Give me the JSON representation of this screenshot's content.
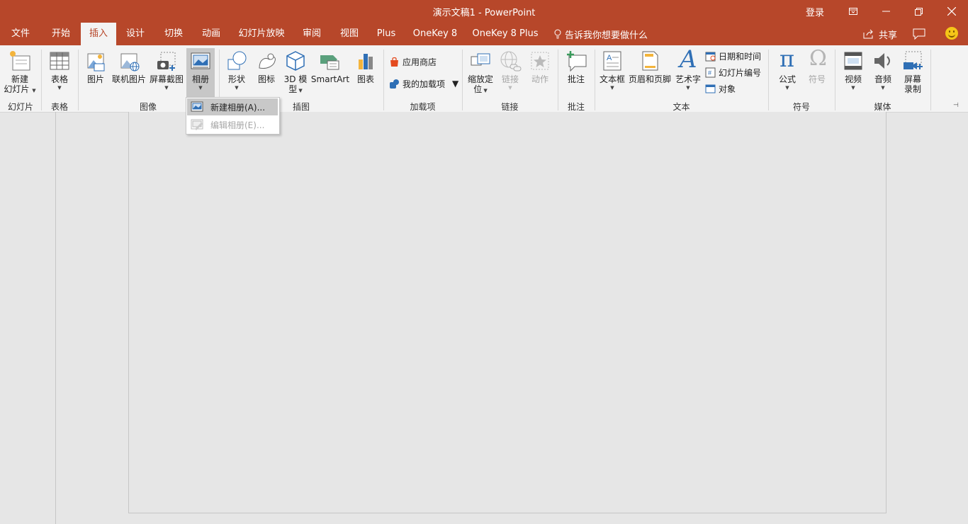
{
  "titlebar": {
    "doc_title": "演示文稿1  -  PowerPoint",
    "login": "登录"
  },
  "tabs": [
    {
      "label": "文件"
    },
    {
      "label": "开始"
    },
    {
      "label": "插入",
      "active": true
    },
    {
      "label": "设计"
    },
    {
      "label": "切换"
    },
    {
      "label": "动画"
    },
    {
      "label": "幻灯片放映"
    },
    {
      "label": "审阅"
    },
    {
      "label": "视图"
    },
    {
      "label": "Plus"
    },
    {
      "label": "OneKey 8"
    },
    {
      "label": "OneKey 8 Plus"
    }
  ],
  "tell_me": "告诉我你想要做什么",
  "share": "共享",
  "ribbon": {
    "groups": {
      "slides": "幻灯片",
      "tables": "表格",
      "images": "图像",
      "illustrations": "插图",
      "addins": "加载项",
      "links": "链接",
      "comments": "批注",
      "text": "文本",
      "symbols": "符号",
      "media": "媒体"
    },
    "buttons": {
      "new_slide_1": "新建",
      "new_slide_2": "幻灯片",
      "table": "表格",
      "pictures": "图片",
      "online_pictures": "联机图片",
      "screenshot": "屏幕截图",
      "photo_album": "相册",
      "shapes": "形状",
      "icons": "图标",
      "model3d_1": "3D 模",
      "model3d_2": "型",
      "smartart": "SmartArt",
      "chart": "图表",
      "store": "应用商店",
      "my_addins": "我的加载项",
      "zoom_1": "缩放定",
      "zoom_2": "位",
      "link": "链接",
      "action": "动作",
      "comment": "批注",
      "textbox": "文本框",
      "header_footer": "页眉和页脚",
      "wordart": "艺术字",
      "datetime": "日期和时间",
      "slide_number": "幻灯片编号",
      "object": "对象",
      "equation": "公式",
      "symbol": "符号",
      "video": "视频",
      "audio": "音频",
      "screen_rec_1": "屏幕",
      "screen_rec_2": "录制"
    },
    "icon_glyphs": {
      "pi": "π",
      "omega": "Ω",
      "wordart": "A"
    }
  },
  "album_menu": {
    "new_album": "新建相册(A)...",
    "edit_album": "编辑相册(E)..."
  },
  "colors": {
    "accent": "#b7472a",
    "ribbon_bg": "#f3f3f3",
    "workspace": "#e6e6e6"
  }
}
